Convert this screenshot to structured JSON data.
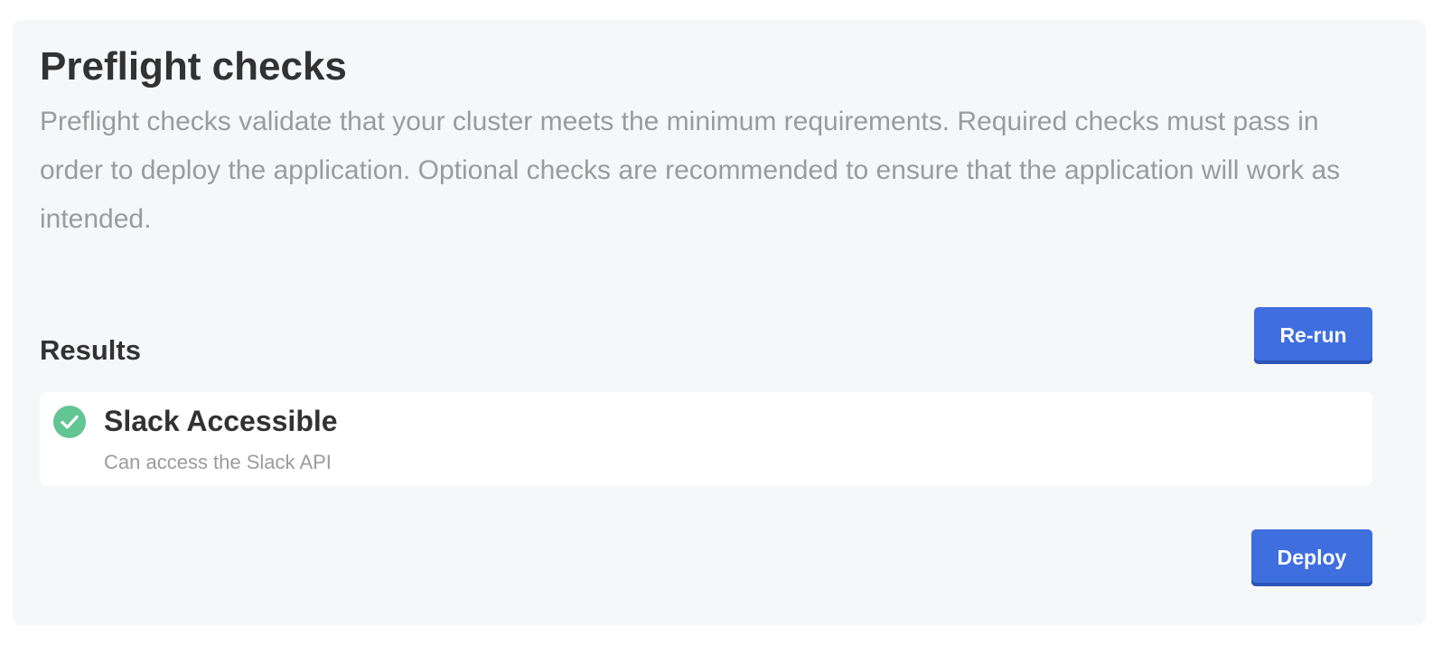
{
  "header": {
    "title": "Preflight checks",
    "description": "Preflight checks validate that your cluster meets the minimum requirements. Required checks must pass in order to deploy the application. Optional checks are recommended to ensure that the application will work as intended."
  },
  "results": {
    "heading": "Results",
    "rerun_label": "Re-run",
    "items": [
      {
        "status": "pass",
        "status_icon": "check-circle-icon",
        "title": "Slack Accessible",
        "message": "Can access the Slack API"
      }
    ]
  },
  "footer": {
    "deploy_label": "Deploy"
  },
  "colors": {
    "panel_background": "#f6f7f9",
    "primary_button": "#3f6ede",
    "pass": "#62c593",
    "heading_text": "#323232",
    "muted_text": "#9b9b9b"
  }
}
